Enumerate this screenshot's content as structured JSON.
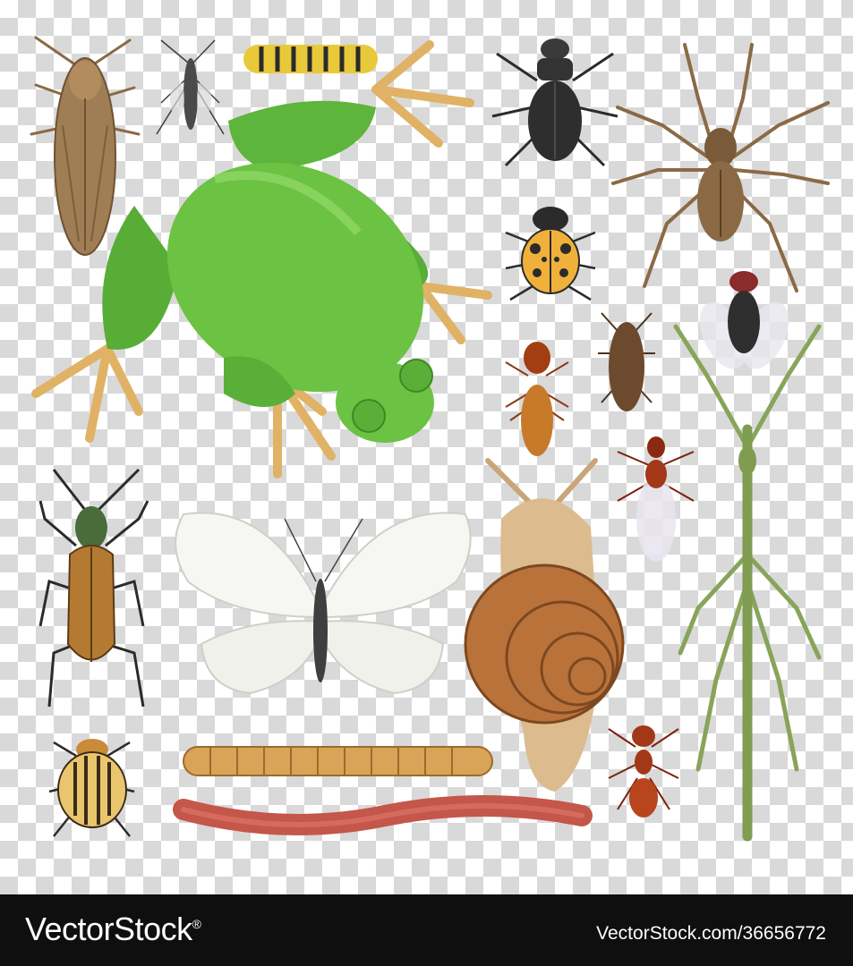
{
  "footer": {
    "brand": "VectorStock",
    "trademark": "®",
    "credit": "VectorStock.com/36656772"
  },
  "colors": {
    "footer_bg": "#0f0f0f",
    "checker_light": "#ffffff",
    "checker_dark": "#d9d9d9"
  }
}
